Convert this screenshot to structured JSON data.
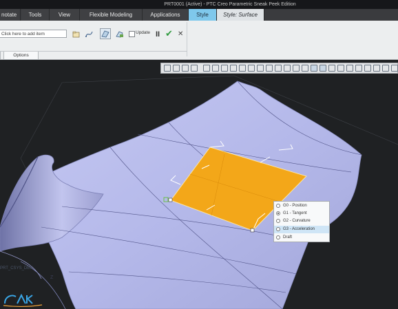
{
  "window": {
    "title": "PRT0001 (Active) - PTC Creo Parametric Sneak Peek Edition"
  },
  "ribbon_tabs": [
    "notate",
    "Tools",
    "View",
    "Flexible Modeling",
    "Applications",
    "Style",
    "Style: Surface"
  ],
  "ribbon": {
    "collector_placeholder": "Click here to add item",
    "update_label": "Update",
    "pause_symbol": "II",
    "ok_symbol": "✔",
    "cancel_symbol": "✕"
  },
  "subtabs": [
    "Options"
  ],
  "context_menu": {
    "items": [
      {
        "label": "G0 - Position",
        "selected": false,
        "highlighted": false
      },
      {
        "label": "G1 - Tangent",
        "selected": true,
        "highlighted": false
      },
      {
        "label": "G2 - Curvature",
        "selected": false,
        "highlighted": false
      },
      {
        "label": "G3 - Acceleration",
        "selected": false,
        "highlighted": true
      },
      {
        "label": "Draft",
        "selected": false,
        "highlighted": false
      }
    ]
  },
  "viewport": {
    "coord_label": "PRT_CSYS_DEF",
    "axis_label": "Z"
  },
  "colors": {
    "surface": "#b7bbe8",
    "selected_patch": "#f3a719",
    "accent": "#7fc8ec"
  }
}
